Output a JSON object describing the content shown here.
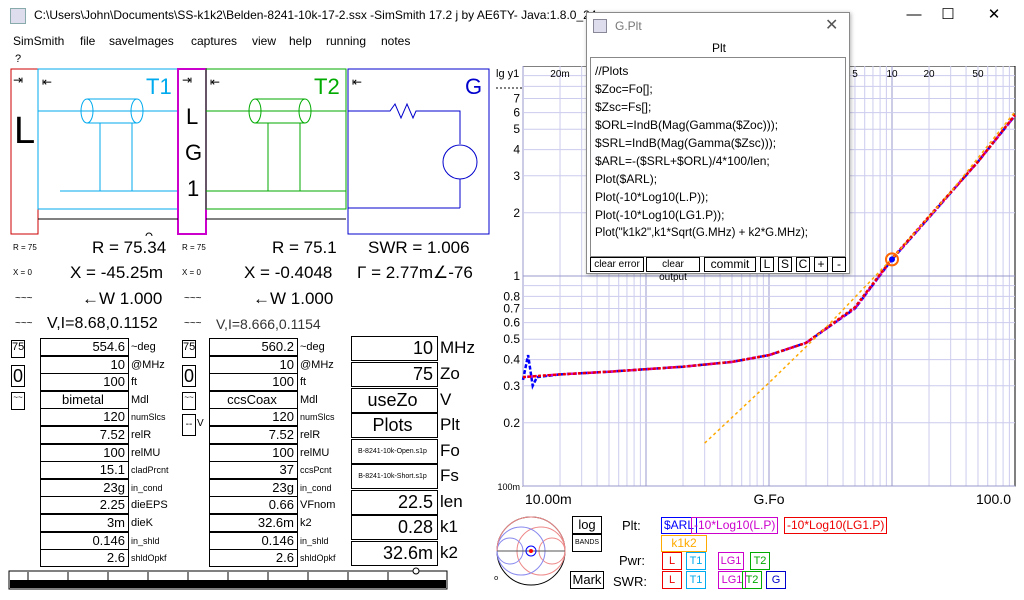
{
  "window": {
    "title": "C:\\Users\\John\\Documents\\SS-k1k2\\Belden-8241-10k-17-2.ssx  -SimSmith 17.2 j by AE6TY-    Java:1.8.0_24"
  },
  "menu": [
    "SimSmith",
    "file",
    "saveImages",
    "captures",
    "view",
    "help",
    "running",
    "notes"
  ],
  "help_mark": "?",
  "circuit": {
    "load_letter": "L",
    "lg_letters": [
      "L",
      "G",
      "1"
    ],
    "t1_label": "T1",
    "t2_label": "T2",
    "g_label": "G"
  },
  "readouts": {
    "left": {
      "r": "R = 75.34",
      "x": "X = -45.25m",
      "w": "←W 1.000",
      "vi": "V,I=8.68,0.1152"
    },
    "right": {
      "r": "R = 75.1",
      "x": "X = -0.4048",
      "w": "←W 1.000",
      "vi": "V,I=8.666,0.1154"
    },
    "swr": "SWR = 1.006",
    "gamma": "Γ = 2.77m∠-76",
    "small": {
      "r75": "R = 75",
      "x0": "X = 0"
    }
  },
  "t1": {
    "zo": "75",
    "zero": "0",
    "rows": [
      {
        "value": "554.6",
        "label": "~deg"
      },
      {
        "value": "10",
        "label": "@MHz"
      },
      {
        "value": "100",
        "label": "ft"
      },
      {
        "value": "bimetal",
        "label": "Mdl"
      },
      {
        "value": "120",
        "label": "numSlcs"
      },
      {
        "value": "7.52",
        "label": "relR"
      },
      {
        "value": "100",
        "label": "relMU"
      },
      {
        "value": "15.1",
        "label": "cladPrcnt"
      },
      {
        "value": "23g",
        "label": "in_cond"
      },
      {
        "value": "2.25",
        "label": "dieEPS"
      },
      {
        "value": "3m",
        "label": "dieK"
      },
      {
        "value": "0.146",
        "label": "in_shld"
      },
      {
        "value": "2.6",
        "label": "shldOpkf"
      }
    ]
  },
  "t2": {
    "zo": "75",
    "zero": "0",
    "dashv": "-- V",
    "rows": [
      {
        "value": "560.2",
        "label": "~deg"
      },
      {
        "value": "10",
        "label": "@MHz"
      },
      {
        "value": "100",
        "label": "ft"
      },
      {
        "value": "ccsCoax",
        "label": "Mdl"
      },
      {
        "value": "120",
        "label": "numSlcs"
      },
      {
        "value": "7.52",
        "label": "relR"
      },
      {
        "value": "100",
        "label": "relMU"
      },
      {
        "value": "37",
        "label": "ccsPcnt"
      },
      {
        "value": "23g",
        "label": "in_cond"
      },
      {
        "value": "0.66",
        "label": "VFnom"
      },
      {
        "value": "32.6m",
        "label": "k2"
      },
      {
        "value": "0.146",
        "label": "in_shld"
      },
      {
        "value": "2.6",
        "label": "shldOpkf"
      }
    ]
  },
  "gen": {
    "rows": [
      {
        "value": "10",
        "label": "MHz"
      },
      {
        "value": "75",
        "label": "Zo"
      },
      {
        "value": "useZo",
        "label": "V"
      },
      {
        "value": "Plots",
        "label": "Plt"
      },
      {
        "value": "B-8241-10k-Open.s1p",
        "label": "Fo"
      },
      {
        "value": "B-8241-10k-Short.s1p",
        "label": "Fs"
      },
      {
        "value": "22.5",
        "label": "len"
      },
      {
        "value": "0.28",
        "label": "k1"
      },
      {
        "value": "32.6m",
        "label": "k2"
      }
    ]
  },
  "plt_window": {
    "title": "G.Plt",
    "heading": "Plt",
    "code": [
      "//Plots",
      "$Zoc=Fo[];",
      "$Zsc=Fs[];",
      "$ORL=IndB(Mag(Gamma($Zoc)));",
      "$SRL=IndB(Mag(Gamma($Zsc)));",
      "$ARL=-($SRL+$ORL)/4*100/len;",
      "Plot($ARL);",
      "Plot(-10*Log10(L.P));",
      "Plot(-10*Log10(LG1.P));",
      "Plot(\"k1k2\",k1*Sqrt(G.MHz) + k2*G.MHz);"
    ],
    "buttons": [
      "clear error",
      "clear output",
      "commit",
      "L",
      "S",
      "C",
      "+",
      "-"
    ]
  },
  "chart_data": {
    "type": "line",
    "xscale": "log",
    "yscale": "log",
    "xlim": [
      0.01,
      100
    ],
    "ylim": [
      0.1,
      10
    ],
    "xlabel": "G.Fo",
    "ylabel": "lg y1",
    "x_tick_labels_bottom": [
      "10.00m",
      "G.Fo",
      "100.0"
    ],
    "x_tick_labels_top": [
      "20m",
      "5",
      "10",
      "20",
      "50"
    ],
    "y_tick_labels": [
      "7",
      "6",
      "5",
      "4",
      "3",
      "2",
      "1",
      "0.8",
      "0.7",
      "0.6",
      "0.5",
      "0.4",
      "0.3",
      "0.2",
      "100m"
    ],
    "series": [
      {
        "name": "$ARL",
        "color": "#0000ff",
        "x": [
          0.01,
          0.011,
          0.012,
          0.013,
          0.02,
          0.05,
          0.1,
          0.2,
          0.5,
          1,
          2,
          5,
          10,
          20,
          50,
          100
        ],
        "y": [
          0.32,
          0.42,
          0.3,
          0.33,
          0.34,
          0.35,
          0.36,
          0.37,
          0.39,
          0.42,
          0.48,
          0.7,
          1.2,
          1.9,
          3.5,
          5.8
        ]
      },
      {
        "name": "-10*Log10(L.P)",
        "color": "#cc00cc",
        "x": [
          0.01,
          0.02,
          0.05,
          0.1,
          0.2,
          0.5,
          1,
          2,
          5,
          10,
          20,
          50,
          100
        ],
        "y": [
          0.33,
          0.34,
          0.35,
          0.36,
          0.37,
          0.39,
          0.42,
          0.48,
          0.7,
          1.2,
          1.9,
          3.5,
          5.8
        ]
      },
      {
        "name": "-10*Log10(LG1.P)",
        "color": "#ee0000",
        "x": [
          0.01,
          0.02,
          0.05,
          0.1,
          0.2,
          0.5,
          1,
          2,
          5,
          10,
          20,
          50,
          100
        ],
        "y": [
          0.33,
          0.34,
          0.35,
          0.36,
          0.37,
          0.39,
          0.42,
          0.48,
          0.71,
          1.21,
          1.92,
          3.5,
          5.85
        ]
      },
      {
        "name": "k1k2",
        "color": "#ffaa00",
        "x": [
          0.3,
          1,
          3,
          10,
          30,
          100
        ],
        "y": [
          0.16,
          0.31,
          0.58,
          1.21,
          2.51,
          6.06
        ]
      }
    ],
    "marker": {
      "x": 10,
      "y": 1.2
    }
  },
  "bottom": {
    "log_btn": "log",
    "bands_btn": "BANDS",
    "mark_btn": "Mark",
    "plt_label": "Plt:",
    "pwr_label": "Pwr:",
    "swr_label": "SWR:",
    "legends": [
      "$ARL",
      "-10*Log10(L.P)",
      "-10*Log10(LG1.P)",
      "k1k2"
    ],
    "pwr_items": [
      "L",
      "T1",
      "LG1",
      "T2"
    ],
    "swr_items": [
      "L",
      "T1",
      "LG1",
      "T2",
      "G"
    ]
  },
  "colors": {
    "t1": "#00aaee",
    "t2": "#00aa00",
    "g": "#0000cc",
    "load": "#cc0000",
    "lg": "#cc00cc",
    "arl": "#0000ff",
    "lp": "#cc00cc",
    "lg1p": "#ee0000",
    "k1k2": "#ffaa00"
  }
}
